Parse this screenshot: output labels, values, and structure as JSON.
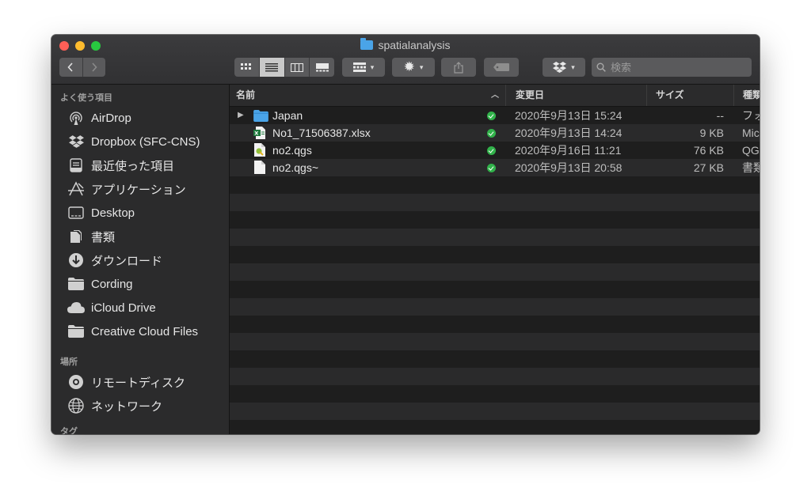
{
  "window": {
    "title": "spatialanalysis"
  },
  "toolbar": {
    "search_placeholder": "検索"
  },
  "sidebar": {
    "favorites_header": "よく使う項目",
    "favorites": [
      {
        "label": "AirDrop",
        "icon": "airdrop-icon"
      },
      {
        "label": "Dropbox (SFC-CNS)",
        "icon": "dropbox-icon"
      },
      {
        "label": "最近使った項目",
        "icon": "recents-icon"
      },
      {
        "label": "アプリケーション",
        "icon": "applications-icon"
      },
      {
        "label": "Desktop",
        "icon": "desktop-icon"
      },
      {
        "label": "書類",
        "icon": "documents-icon"
      },
      {
        "label": "ダウンロード",
        "icon": "downloads-icon"
      },
      {
        "label": "Cording",
        "icon": "folder-icon"
      },
      {
        "label": "iCloud Drive",
        "icon": "icloud-icon"
      },
      {
        "label": "Creative Cloud Files",
        "icon": "folder-icon"
      }
    ],
    "locations_header": "場所",
    "locations": [
      {
        "label": "リモートディスク",
        "icon": "remote-disc-icon"
      },
      {
        "label": "ネットワーク",
        "icon": "network-icon"
      }
    ],
    "tags_header": "タグ"
  },
  "columns": {
    "name": "名前",
    "date": "変更日",
    "size": "サイズ",
    "kind": "種類"
  },
  "files": [
    {
      "name": "Japan",
      "date": "2020年9月13日 15:24",
      "size": "--",
      "kind": "フォ",
      "type": "folder"
    },
    {
      "name": "No1_71506387.xlsx",
      "date": "2020年9月13日 14:24",
      "size": "9 KB",
      "kind": "Mic",
      "type": "xlsx"
    },
    {
      "name": "no2.qgs",
      "date": "2020年9月16日 11:21",
      "size": "76 KB",
      "kind": "QG",
      "type": "qgs"
    },
    {
      "name": "no2.qgs~",
      "date": "2020年9月13日 20:58",
      "size": "27 KB",
      "kind": "書類",
      "type": "doc"
    }
  ],
  "colors": {
    "sync_ok": "#31b24a",
    "folder_blue": "#4aa4e8",
    "close": "#ff5f57",
    "minimize": "#febc2e",
    "zoom": "#28c840"
  }
}
